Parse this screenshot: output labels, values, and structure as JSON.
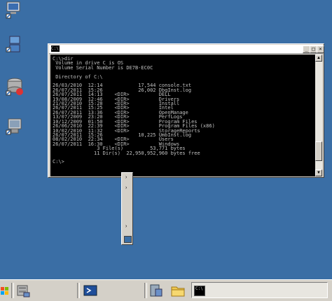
{
  "window": {
    "icon_label": "C:\\",
    "lines": [
      "C:\\>dir",
      " Volume in drive C is OS",
      " Volume Serial Number is DE7B-EC0C",
      "",
      " Directory of C:\\",
      "",
      "26/03/2010  12:14            17,544 console.txt",
      "26/07/2011  15:26            26,002 DbgInst.log",
      "26/07/2011  14:13    <DIR>          DELL",
      "19/08/2009  12:46    <DIR>          Drivers",
      "21/02/2010  15:28    <DIR>          Install",
      "26/07/2011  15:25    <DIR>          Intel",
      "26/07/2011  13:36    <DIR>          OpenManage",
      "13/07/2009  23:20    <DIR>          PerfLogs",
      "10/12/2009  01:50    <DIR>          Program Files",
      "26/06/2010  22:39    <DIR>          Program Files (x86)",
      "10/02/2010  11:32    <DIR>          StorageReports",
      "26/07/2011  15:26            10,225 UmbInst.log",
      "08/02/2010  22:34    <DIR>          Users",
      "26/07/2011  16:30    <DIR>          Windows",
      "               3 File(s)         53,771 bytes",
      "              11 Dir(s)  22,950,952,960 bytes free",
      "",
      "C:\\>"
    ]
  },
  "taskbar": {
    "console_icon_label": "C:\\"
  }
}
